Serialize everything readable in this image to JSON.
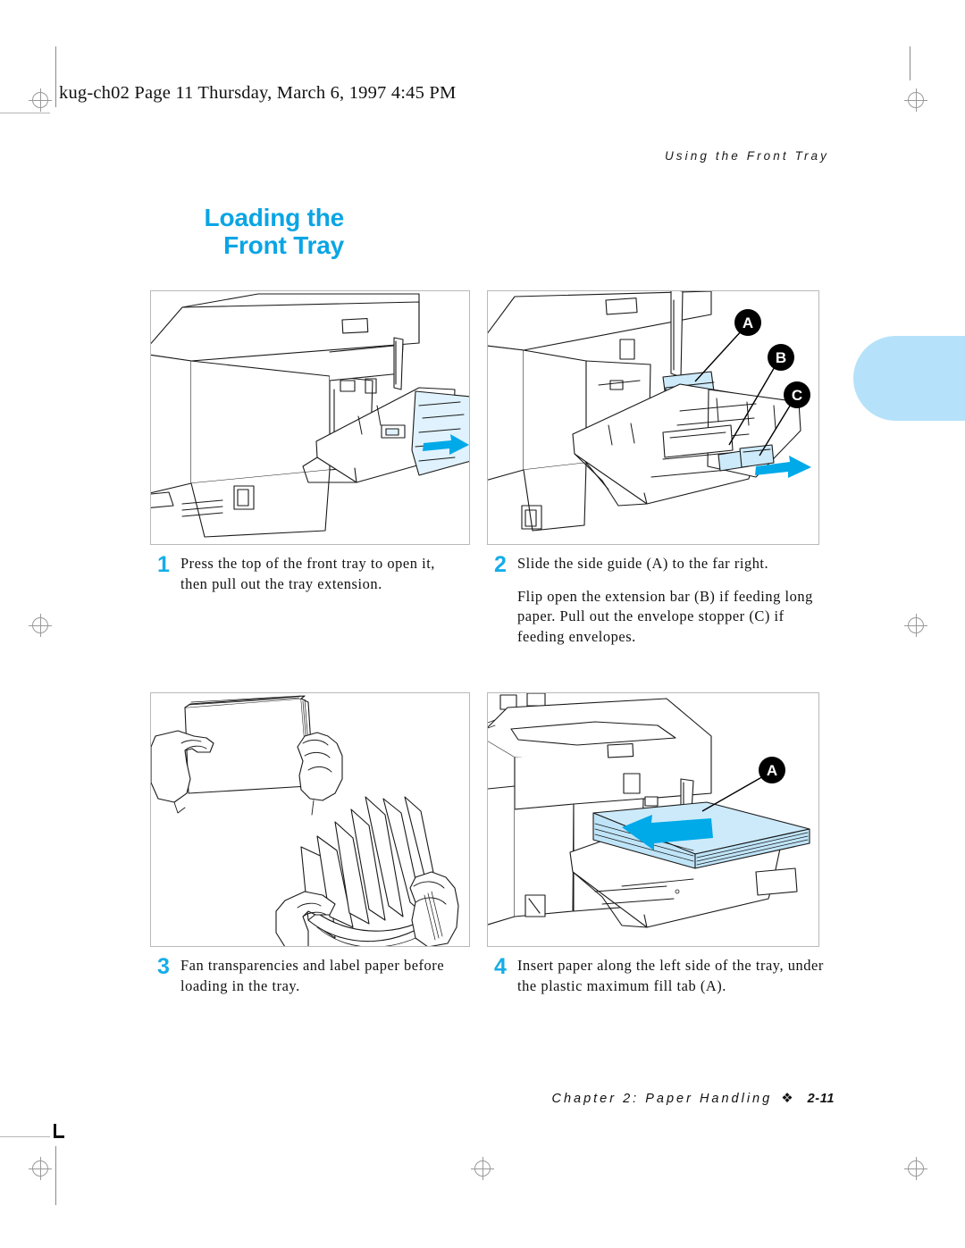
{
  "doc_header": "kug-ch02  Page 11  Thursday, March 6, 1997  4:45 PM",
  "running_head": "Using the Front Tray",
  "section_title": {
    "line1": "Loading the",
    "line2": "Front Tray"
  },
  "colors": {
    "title_blue": "#0aa5e4",
    "step_number_blue": "#14ade8",
    "arrow_cyan": "#00a9e8",
    "paper_fill": "#cdeafa",
    "tab_blue": "#b5e2fa",
    "callout_black": "#000000",
    "panel_border": "#b9b9b9"
  },
  "steps": [
    {
      "number": "1",
      "paragraphs": [
        "Press the top of the front tray to open it, then pull out the tray extension."
      ]
    },
    {
      "number": "2",
      "paragraphs": [
        "Slide the side guide (A) to the far right.",
        "Flip open the extension bar (B) if feeding long paper. Pull out the envelope stopper (C) if feeding envelopes."
      ]
    },
    {
      "number": "3",
      "paragraphs": [
        "Fan transparencies and label paper before loading in the tray."
      ]
    },
    {
      "number": "4",
      "paragraphs": [
        "Insert paper along the left side of the tray, under the plastic maximum fill tab (A)."
      ]
    }
  ],
  "figures": [
    {
      "id": "figure-1",
      "caption": "Printer with front tray open and tray extension pulled out",
      "callouts": [],
      "arrow_direction": "right"
    },
    {
      "id": "figure-2",
      "caption": "Front tray detail showing side guide, extension bar and envelope stopper",
      "callouts": [
        "A",
        "B",
        "C"
      ],
      "arrow_direction": "right"
    },
    {
      "id": "figure-3",
      "caption": "Hands fanning a stack of paper",
      "callouts": [],
      "arrow_direction": "none"
    },
    {
      "id": "figure-4",
      "caption": "Paper stack inserted into the front tray under the maximum fill tab",
      "callouts": [
        "A"
      ],
      "arrow_direction": "left"
    }
  ],
  "footer": {
    "chapter": "Chapter 2: Paper Handling",
    "separator": "❖",
    "page": "2-11"
  }
}
